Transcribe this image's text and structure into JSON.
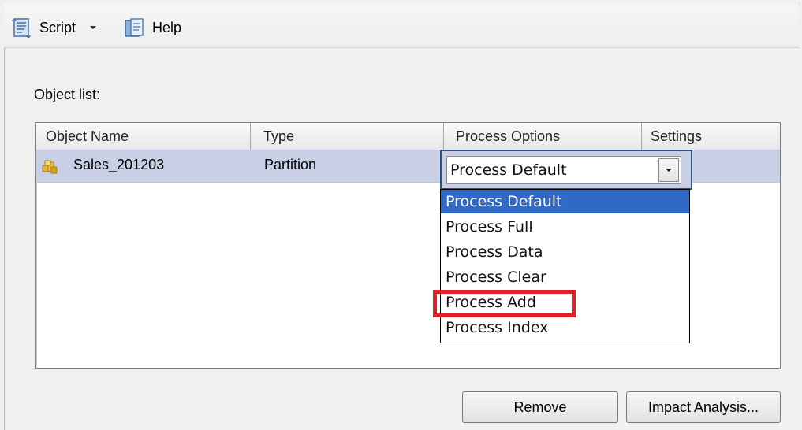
{
  "toolbar": {
    "script_label": "Script",
    "help_label": "Help"
  },
  "object_list": {
    "label": "Object list:",
    "columns": [
      "Object Name",
      "Type",
      "Process Options",
      "Settings"
    ],
    "rows": [
      {
        "object_name": "Sales_201203",
        "type": "Partition",
        "process_option": "Process Default",
        "settings": ""
      }
    ]
  },
  "process_options_dropdown": {
    "selected": "Process Default",
    "options": [
      "Process Default",
      "Process Full",
      "Process Data",
      "Process Clear",
      "Process Add",
      "Process Index"
    ],
    "highlighted_option": "Process Add"
  },
  "buttons": {
    "remove": "Remove",
    "impact_analysis": "Impact Analysis..."
  },
  "colors": {
    "selection": "#3169c6",
    "row_highlight": "#c9d0e6",
    "annotation_red": "#e0212a"
  },
  "icons": {
    "script": "script-icon",
    "help": "help-icon",
    "dropdown": "chevron-down-icon",
    "partition": "partition-icon"
  }
}
